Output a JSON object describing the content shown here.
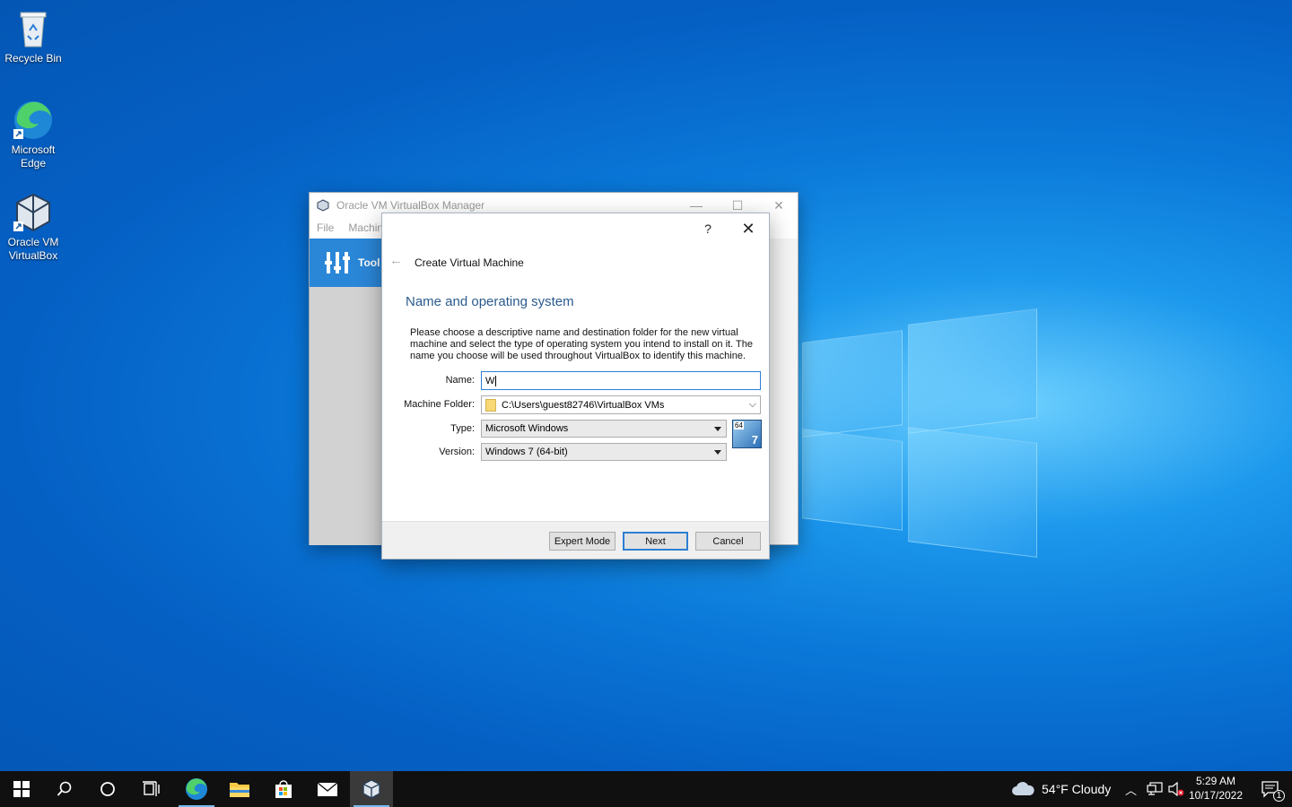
{
  "desktop": {
    "icons": [
      {
        "label": "Recycle Bin",
        "icon": "recycle-bin-icon"
      },
      {
        "label": "Microsoft Edge",
        "icon": "edge-icon"
      },
      {
        "label": "Oracle VM VirtualBox",
        "icon": "virtualbox-icon"
      }
    ]
  },
  "manager": {
    "title": "Oracle VM VirtualBox Manager",
    "menu": [
      "File",
      "Machin"
    ],
    "tools_label": "Tool"
  },
  "dialog": {
    "help": "?",
    "title": "Create Virtual Machine",
    "section_title": "Name and operating system",
    "description": "Please choose a descriptive name and destination folder for the new virtual machine and select the type of operating system you intend to install on it. The name you choose will be used throughout VirtualBox to identify this machine.",
    "name_label": "Name:",
    "name_value": "W",
    "folder_label": "Machine Folder:",
    "folder_value": "C:\\Users\\guest82746\\VirtualBox VMs",
    "type_label": "Type:",
    "type_value": "Microsoft Windows",
    "version_label": "Version:",
    "version_value": "Windows 7 (64-bit)",
    "os_badge_bits": "64",
    "os_badge_version": "7",
    "buttons": {
      "expert": "Expert Mode",
      "next": "Next",
      "cancel": "Cancel"
    }
  },
  "taskbar": {
    "weather": "54°F  Cloudy",
    "time": "5:29 AM",
    "date": "10/17/2022",
    "notification_count": "1"
  },
  "colors": {
    "accent": "#2d7fd3",
    "section_title": "#2b5a8e",
    "taskbar": "#101010"
  }
}
